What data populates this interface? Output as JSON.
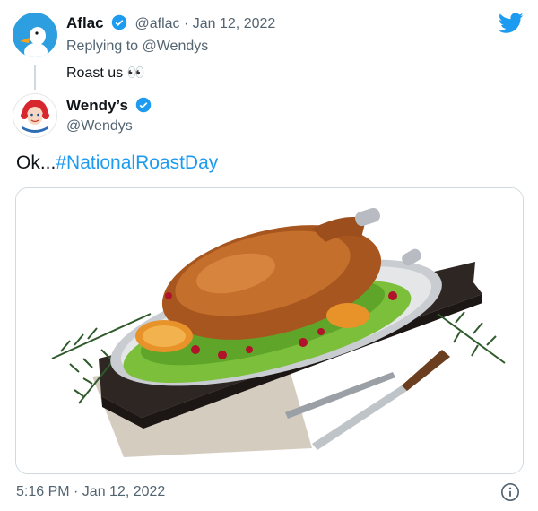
{
  "reply_tweet": {
    "display_name": "Aflac",
    "handle": "@aflac",
    "separator": "·",
    "date": "Jan 12, 2022",
    "replying_to": "Replying to @Wendys",
    "text": "Roast us 👀"
  },
  "main_tweet": {
    "display_name": "Wendy’s",
    "handle": "@Wendys",
    "text_prefix": "Ok...",
    "hashtag": "#NationalRoastDay",
    "timestamp": "5:16 PM · Jan 12, 2022"
  },
  "icons": {
    "brand": "twitter-bird-icon",
    "verified": "verified-badge-icon",
    "info": "info-icon"
  },
  "colors": {
    "link": "#1d9bf0",
    "verified": "#1d9bf0",
    "secondary_text": "#536471"
  }
}
